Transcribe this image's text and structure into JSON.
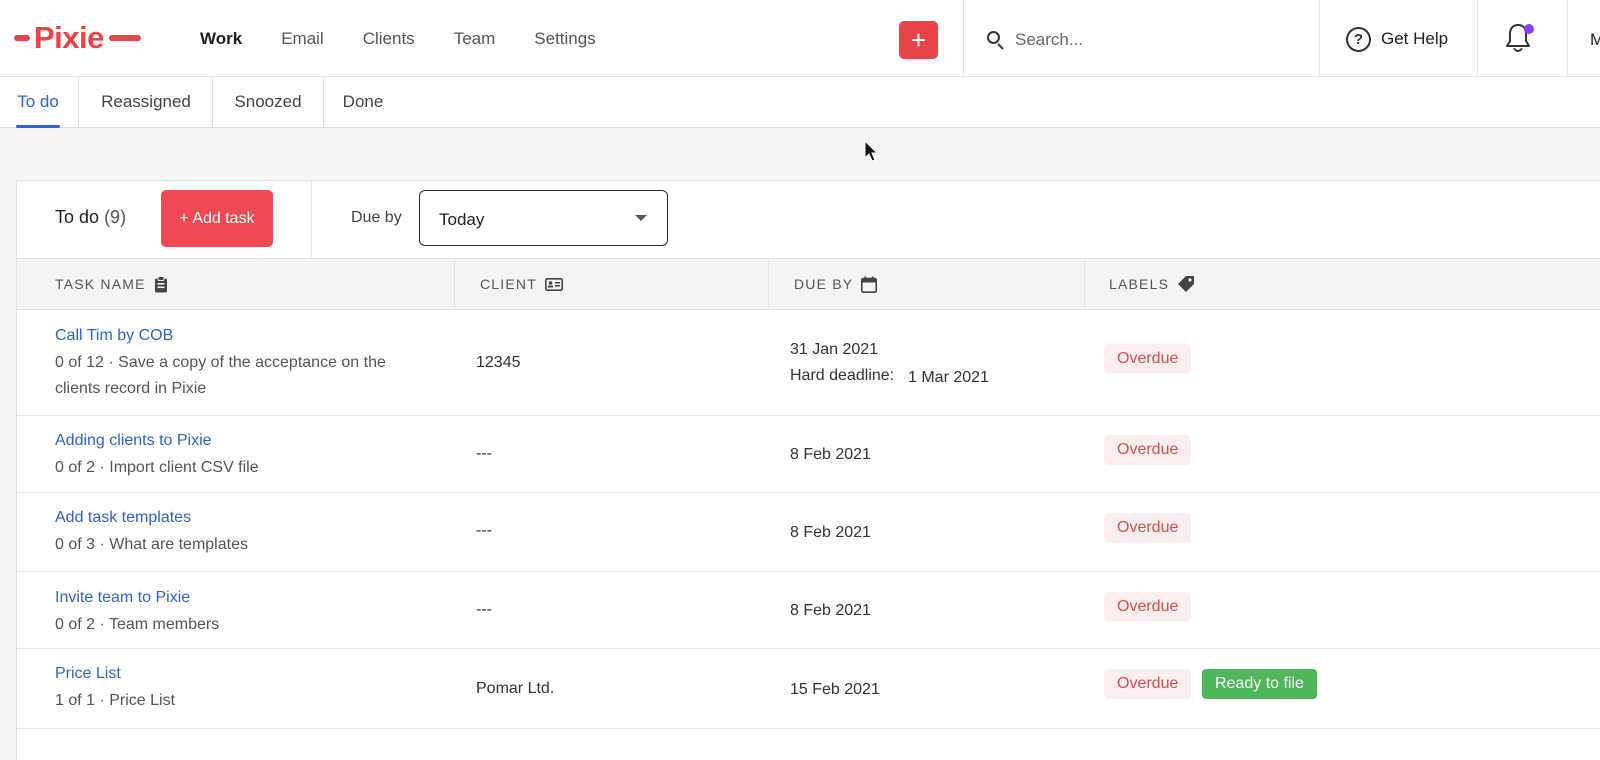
{
  "app": {
    "logo_text": "Pixie",
    "brand_color": "#e8424b"
  },
  "nav": {
    "items": [
      {
        "label": "Work",
        "active": true
      },
      {
        "label": "Email",
        "active": false
      },
      {
        "label": "Clients",
        "active": false
      },
      {
        "label": "Team",
        "active": false
      },
      {
        "label": "Settings",
        "active": false
      }
    ],
    "add_icon": "plus-icon",
    "search_placeholder": "Search...",
    "help_label": "Get Help",
    "notification_icon": "bell-icon",
    "user_initial": "M"
  },
  "subtabs": [
    {
      "label": "To do",
      "active": true
    },
    {
      "label": "Reassigned",
      "active": false
    },
    {
      "label": "Snoozed",
      "active": false
    },
    {
      "label": "Done",
      "active": false
    }
  ],
  "panel": {
    "title": "To do",
    "count": "(9)",
    "add_task_label": "+ Add task",
    "due_by_label": "Due by",
    "due_by_value": "Today"
  },
  "table": {
    "columns": [
      {
        "label": "TASK NAME",
        "icon": "clipboard-icon"
      },
      {
        "label": "CLIENT",
        "icon": "id-card-icon"
      },
      {
        "label": "DUE BY",
        "icon": "calendar-icon"
      },
      {
        "label": "LABELS",
        "icon": "tag-icon"
      }
    ],
    "rows": [
      {
        "name": "Call Tim by COB",
        "subtitle": "0 of 12 · Save a copy of the acceptance on the clients record in Pixie",
        "client": "12345",
        "due": "31 Jan 2021",
        "hard_deadline_label": "Hard deadline:",
        "hard_deadline": "1 Mar 2021",
        "labels": [
          "Overdue"
        ]
      },
      {
        "name": "Adding clients to Pixie",
        "subtitle": "0 of 2 · Import client CSV file",
        "client": "---",
        "due": "8 Feb 2021",
        "labels": [
          "Overdue"
        ]
      },
      {
        "name": "Add task templates",
        "subtitle": "0 of 3 · What are templates",
        "client": "---",
        "due": "8 Feb 2021",
        "labels": [
          "Overdue"
        ]
      },
      {
        "name": "Invite team to Pixie",
        "subtitle": "0 of 2 · Team members",
        "client": "---",
        "due": "8 Feb 2021",
        "labels": [
          "Overdue"
        ]
      },
      {
        "name": "Price List",
        "subtitle": "1 of 1 · Price List",
        "client": "Pomar Ltd.",
        "due": "15 Feb 2021",
        "labels": [
          "Overdue",
          "Ready to file"
        ]
      }
    ]
  },
  "colors": {
    "link": "#2f63c8",
    "overdue_bg": "#fbeeee",
    "overdue_text": "#d0524f",
    "ready_bg": "#4fb65a",
    "notification_dot": "#8a3ffc"
  }
}
